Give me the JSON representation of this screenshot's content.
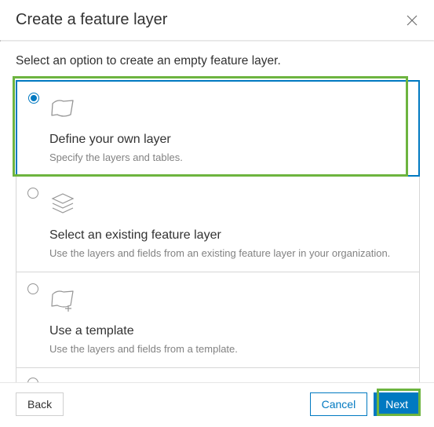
{
  "dialog": {
    "title": "Create a feature layer",
    "instruction": "Select an option to create an empty feature layer."
  },
  "options": [
    {
      "id": "define",
      "title": "Define your own layer",
      "description": "Specify the layers and tables.",
      "selected": true,
      "icon": "layer"
    },
    {
      "id": "existing",
      "title": "Select an existing feature layer",
      "description": "Use the layers and fields from an existing feature layer in your organization.",
      "selected": false,
      "icon": "layers-stack"
    },
    {
      "id": "template",
      "title": "Use a template",
      "description": "Use the layers and fields from a template.",
      "selected": false,
      "icon": "template"
    }
  ],
  "footer": {
    "back": "Back",
    "cancel": "Cancel",
    "next": "Next"
  },
  "highlights": {
    "option_define": true,
    "next_button": true
  }
}
